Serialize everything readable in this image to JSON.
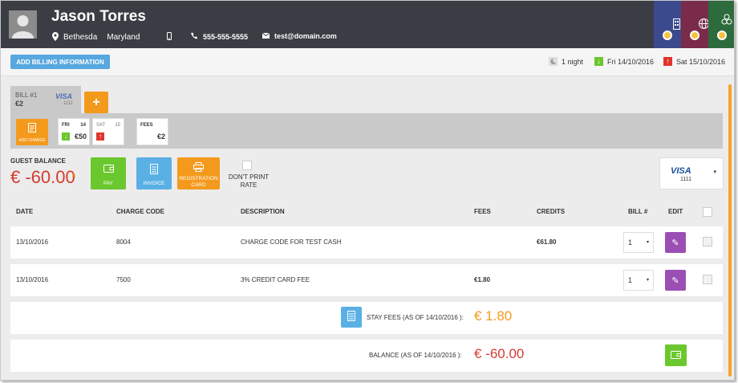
{
  "guest": {
    "name": "Jason Torres",
    "city": "Bethesda",
    "state": "Maryland",
    "phone": "555-555-5555",
    "email": "test@domain.com"
  },
  "colors": {
    "header": "#3a3d44",
    "tile_blue": "#3b4a8c",
    "tile_red": "#7a2b4a",
    "tile_green": "#2e6b3c",
    "accent_orange": "#f39a1d",
    "balance_red": "#d63b2f",
    "edit_purple": "#9b4fb5",
    "pay_green": "#6bc72e",
    "invoice_blue": "#5ab0e5"
  },
  "icons": {
    "header_tiles": [
      "building-icon",
      "globe-icon",
      "network-icon"
    ],
    "location": "map-pin-icon",
    "phone": "mobile-phone-icon",
    "landline": "phone-icon",
    "email": "envelope-icon"
  },
  "topbar": {
    "add_billing_label": "ADD BILLING INFORMATION",
    "nights": "1 night",
    "arrival": "Fri 14/10/2016",
    "departure": "Sat 15/10/2016"
  },
  "bill": {
    "title": "BILL #1",
    "amount": "€2",
    "card_brand": "VISA",
    "card_number": "1111",
    "add_label": "+"
  },
  "charges": {
    "add_charge_label": "ADD CHARGE",
    "days": [
      {
        "dow": "FRI",
        "date": "14",
        "value": "€50",
        "flag": "arrival"
      },
      {
        "dow": "SAT",
        "date": "15",
        "value": "",
        "flag": "departure"
      }
    ],
    "fees_label": "FEES",
    "fees_value": "€2"
  },
  "guest_balance": {
    "label": "GUEST BALANCE",
    "amount": "€ -60.00",
    "chevron": "»"
  },
  "actions": {
    "pay": "PAY",
    "invoice": "INVOICE",
    "registration_card": "REGISTRATION CARD",
    "dont_print_rate": "DON'T PRINT RATE"
  },
  "card_selector": {
    "brand": "VISA",
    "number": "1111",
    "caret": "▾"
  },
  "table": {
    "headers": [
      "DATE",
      "CHARGE CODE",
      "DESCRIPTION",
      "FEES",
      "CREDITS",
      "BILL #",
      "EDIT"
    ],
    "rows": [
      {
        "date": "13/10/2016",
        "code": "8004",
        "description": "CHARGE CODE FOR TEST CASH",
        "fees": "",
        "credits": "€61.80",
        "bill": "1"
      },
      {
        "date": "13/10/2016",
        "code": "7500",
        "description": "3% CREDIT CARD FEE",
        "fees": "€1.80",
        "credits": "",
        "bill": "1"
      }
    ]
  },
  "summary": {
    "stay_fees_label": "STAY FEES (AS OF 14/10/2016 ):",
    "stay_fees_value": "€ 1.80",
    "balance_label": "BALANCE (AS OF 14/10/2016 ):",
    "balance_value": "€ -60.00"
  }
}
